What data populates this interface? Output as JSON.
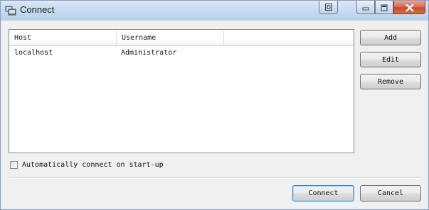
{
  "window": {
    "title": "Connect"
  },
  "titlebar": {
    "app_icon": "connect-app-icon",
    "restore_icon": "restore-window-icon",
    "minimize_icon": "minimize-icon",
    "maximize_icon": "maximize-icon",
    "close_icon": "close-icon"
  },
  "connections": {
    "columns": [
      "Host",
      "Username",
      ""
    ],
    "rows": [
      {
        "host": "localhost",
        "username": "Administrator"
      }
    ]
  },
  "actions": {
    "add_label": "Add",
    "edit_label": "Edit",
    "remove_label": "Remove"
  },
  "autoconnect": {
    "label": "Automatically connect on start-up",
    "checked": false
  },
  "footer": {
    "connect_label": "Connect",
    "cancel_label": "Cancel"
  },
  "colors": {
    "titlebar": "#c6daf0",
    "close_button": "#c64a2b",
    "default_button_border": "#3c7fb1"
  }
}
